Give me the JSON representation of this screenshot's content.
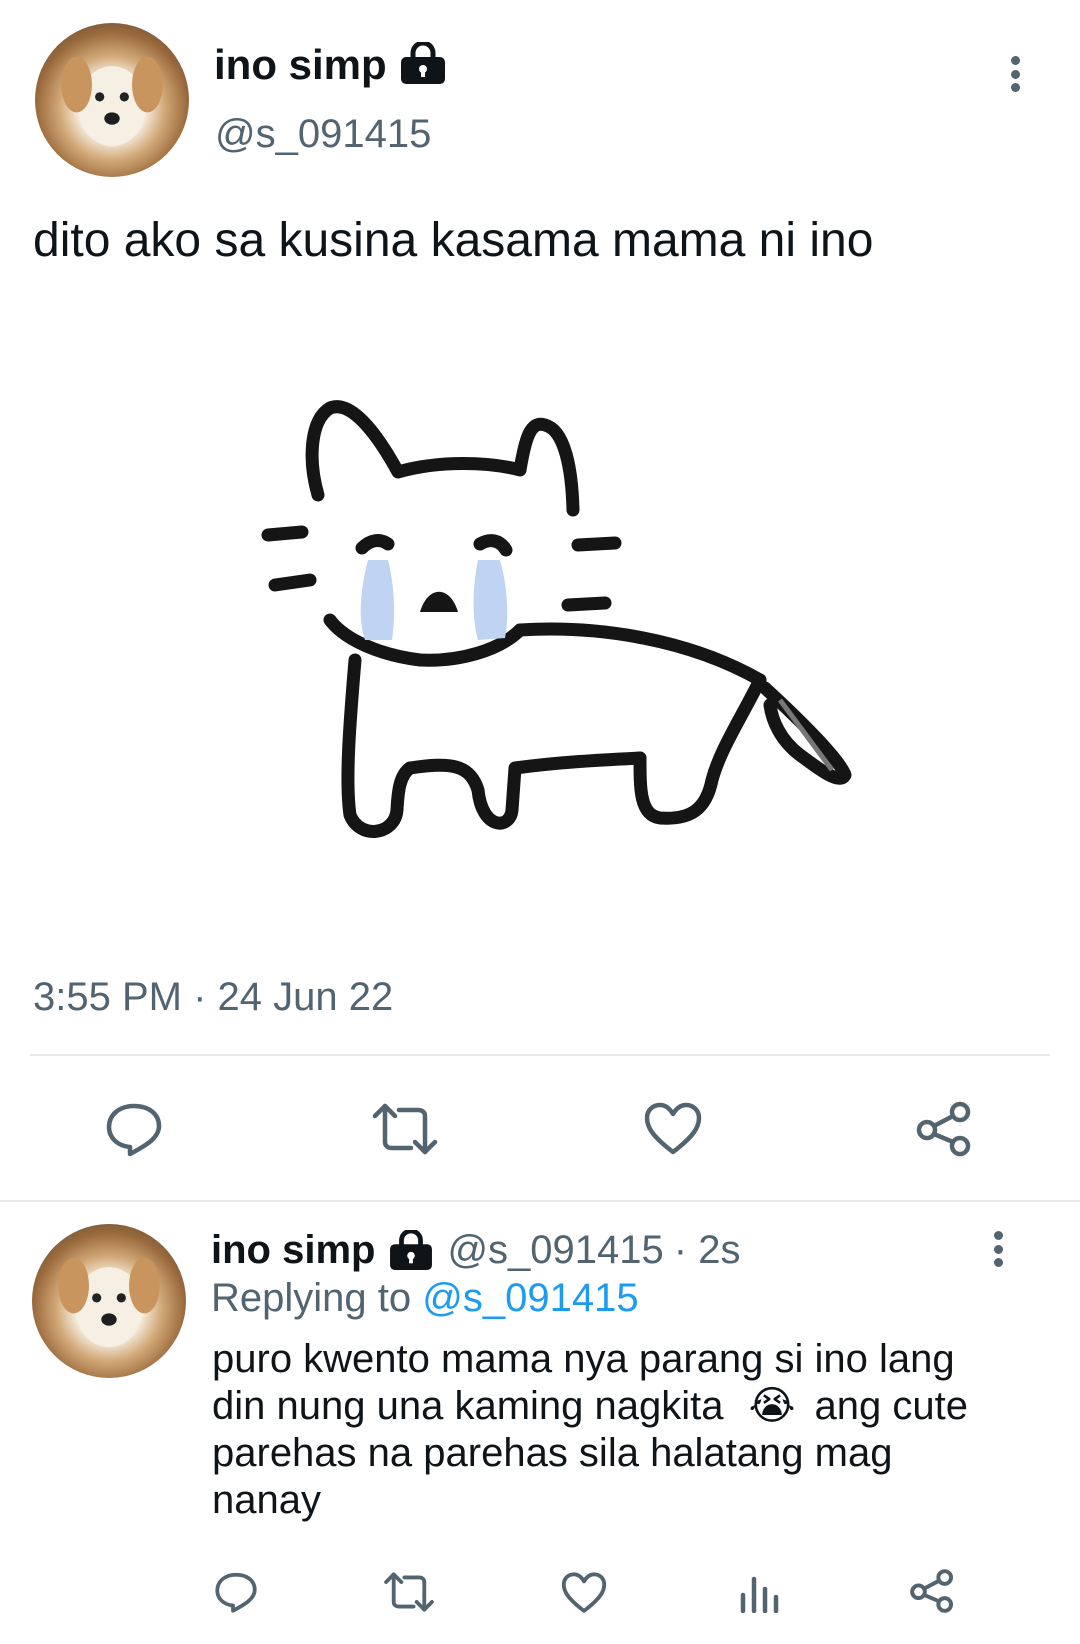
{
  "tweet": {
    "author_name": "ino simp",
    "author_handle": "@s_091415",
    "text": "dito ako sa kusina kasama mama ni ino",
    "timestamp": "3:55 PM · 24 Jun 22",
    "actions": [
      "reply-icon",
      "retweet-icon",
      "like-icon",
      "share-icon"
    ]
  },
  "reply": {
    "author_name": "ino simp",
    "author_handle": "@s_091415",
    "time": "· 2s",
    "replying_prefix": "Replying to",
    "replying_handle": "@s_091415",
    "lines": [
      "puro kwento mama nya parang si ino lang",
      "din nung una kaming nagkita",
      "ang cute",
      "parehas na parehas sila halatang mag",
      "nanay"
    ],
    "emoji": "😭",
    "actions": [
      "reply-icon",
      "retweet-icon",
      "like-icon",
      "views-icon",
      "share-icon"
    ]
  },
  "colors": {
    "text": "#0f1419",
    "muted": "#536471",
    "link": "#1d9bf0",
    "divider": "#e7e9ea"
  }
}
